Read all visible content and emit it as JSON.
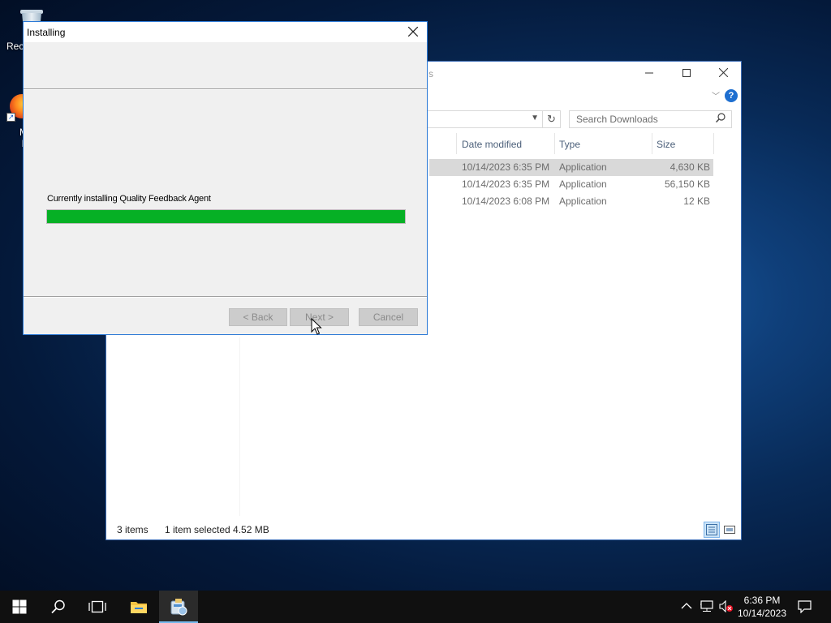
{
  "desktop": {
    "recycle_bin_label": "Rec",
    "firefox_label_line1": "M",
    "firefox_label_line2": "F"
  },
  "explorer": {
    "title_fragment": "s",
    "search_placeholder": "Search Downloads",
    "columns": [
      "Date modified",
      "Type",
      "Size"
    ],
    "files": [
      {
        "date": "10/14/2023 6:35 PM",
        "type": "Application",
        "size": "4,630 KB",
        "selected": true
      },
      {
        "date": "10/14/2023 6:35 PM",
        "type": "Application",
        "size": "56,150 KB",
        "selected": false
      },
      {
        "date": "10/14/2023 6:08 PM",
        "type": "Application",
        "size": "12 KB",
        "selected": false
      }
    ],
    "status": {
      "item_count": "3 items",
      "selection": "1 item selected  4.52 MB"
    }
  },
  "installer": {
    "title": "Installing",
    "status_text": "Currently installing Quality Feedback Agent",
    "progress": 1.0,
    "progress_color": "#06b025",
    "buttons": {
      "back": "< Back",
      "next": "Next >",
      "cancel": "Cancel"
    }
  },
  "taskbar": {
    "time": "6:36 PM",
    "date": "10/14/2023"
  }
}
